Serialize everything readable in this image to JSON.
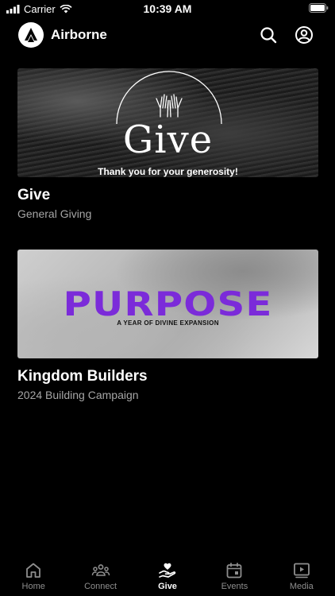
{
  "status": {
    "carrier": "Carrier",
    "time": "10:39 AM"
  },
  "header": {
    "title": "Airborne"
  },
  "cards": [
    {
      "title": "Give",
      "subtitle": "General Giving",
      "banner_word": "Give",
      "banner_tagline": "Thank you for your generosity!"
    },
    {
      "title": "Kingdom Builders",
      "subtitle": "2024 Building Campaign",
      "banner_word": "PURPOSE",
      "banner_tagline": "A YEAR OF DIVINE EXPANSION"
    }
  ],
  "tabs": [
    {
      "label": "Home",
      "icon": "home-icon"
    },
    {
      "label": "Connect",
      "icon": "people-icon"
    },
    {
      "label": "Give",
      "icon": "give-icon",
      "active": true
    },
    {
      "label": "Events",
      "icon": "calendar-icon"
    },
    {
      "label": "Media",
      "icon": "play-icon"
    }
  ],
  "colors": {
    "background": "#000000",
    "purpose_text": "#7b2bd9",
    "subtitle": "#a6a6a6",
    "inactive_tab": "#8e8e8e"
  }
}
